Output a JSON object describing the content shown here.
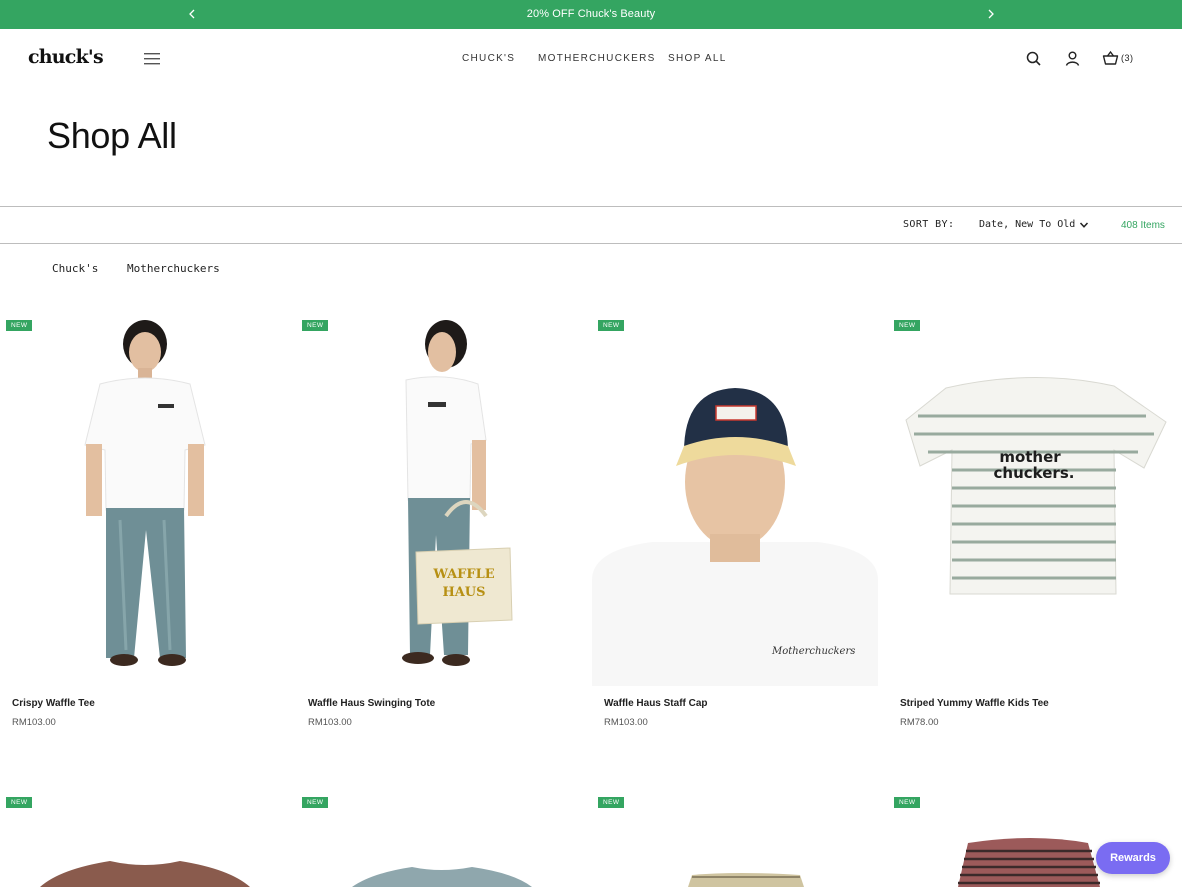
{
  "promo": {
    "text": "20% OFF Chuck's Beauty"
  },
  "header": {
    "logo": "chuck's",
    "nav": [
      "CHUCK'S",
      "MOTHERCHUCKERS",
      "SHOP ALL"
    ],
    "cart_count": "(3)"
  },
  "page": {
    "title": "Shop All"
  },
  "toolbar": {
    "sort_label": "SORT BY:",
    "sort_value": "Date, New To Old",
    "item_count": "408 Items"
  },
  "filters": [
    "Chuck's",
    "Motherchuckers"
  ],
  "products": [
    {
      "badge": "NEW",
      "name": "Crispy Waffle Tee",
      "price": "RM103.00"
    },
    {
      "badge": "NEW",
      "name": "Waffle Haus Swinging Tote",
      "price": "RM103.00"
    },
    {
      "badge": "NEW",
      "name": "Waffle Haus Staff Cap",
      "price": "RM103.00"
    },
    {
      "badge": "NEW",
      "name": "Striped Yummy Waffle Kids Tee",
      "price": "RM78.00"
    },
    {
      "badge": "NEW"
    },
    {
      "badge": "NEW"
    },
    {
      "badge": "NEW"
    },
    {
      "badge": "NEW"
    }
  ],
  "rewards": {
    "label": "Rewards"
  },
  "colors": {
    "brand_green": "#34a561",
    "rewards_purple": "#7a6cf2"
  },
  "icons": [
    "chevron-left-icon",
    "chevron-right-icon",
    "hamburger-menu-icon",
    "search-icon",
    "account-icon",
    "cart-icon",
    "chevron-down-icon"
  ]
}
